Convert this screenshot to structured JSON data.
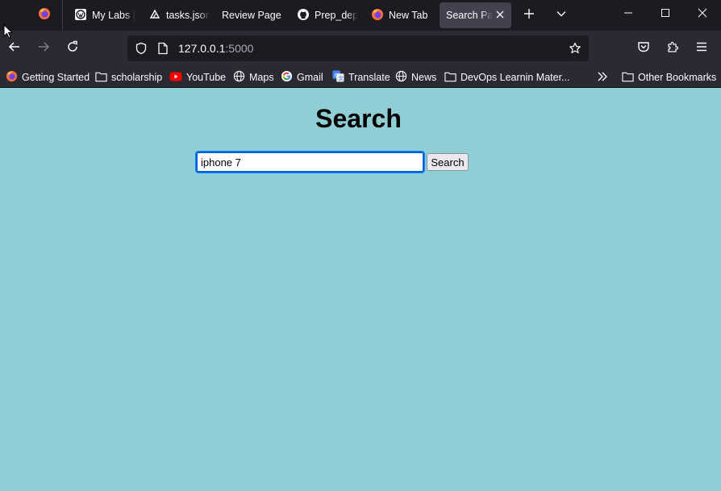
{
  "browser": {
    "tabs": [
      {
        "label": "My Labs | ",
        "icon": "wordpress-icon",
        "active": false
      },
      {
        "label": "tasks.json",
        "icon": "tasks-icon",
        "active": false
      },
      {
        "label": "Review Page",
        "icon": "",
        "active": false
      },
      {
        "label": "Prep_dep",
        "icon": "github-icon",
        "active": false
      },
      {
        "label": "New Tab",
        "icon": "firefox-icon",
        "active": false
      },
      {
        "label": "Search Pag",
        "icon": "",
        "active": true
      }
    ],
    "url": {
      "host": "127.0.0.1",
      "port": ":5000"
    },
    "bookmarks": [
      {
        "label": "Getting Started",
        "icon": "firefox-icon"
      },
      {
        "label": "scholarship",
        "icon": "folder-icon"
      },
      {
        "label": "YouTube",
        "icon": "youtube-icon"
      },
      {
        "label": "Maps",
        "icon": "globe-icon"
      },
      {
        "label": "Gmail",
        "icon": "google-icon"
      },
      {
        "label": "Translate",
        "icon": "translate-icon"
      },
      {
        "label": "News",
        "icon": "globe-icon"
      },
      {
        "label": "DevOps Learnin Mater...",
        "icon": "folder-icon"
      }
    ],
    "other_bookmarks": "Other Bookmarks"
  },
  "page": {
    "title": "Search",
    "search": {
      "value": "iphone 7",
      "button_label": "Search"
    },
    "background_color": "#8fced4"
  }
}
